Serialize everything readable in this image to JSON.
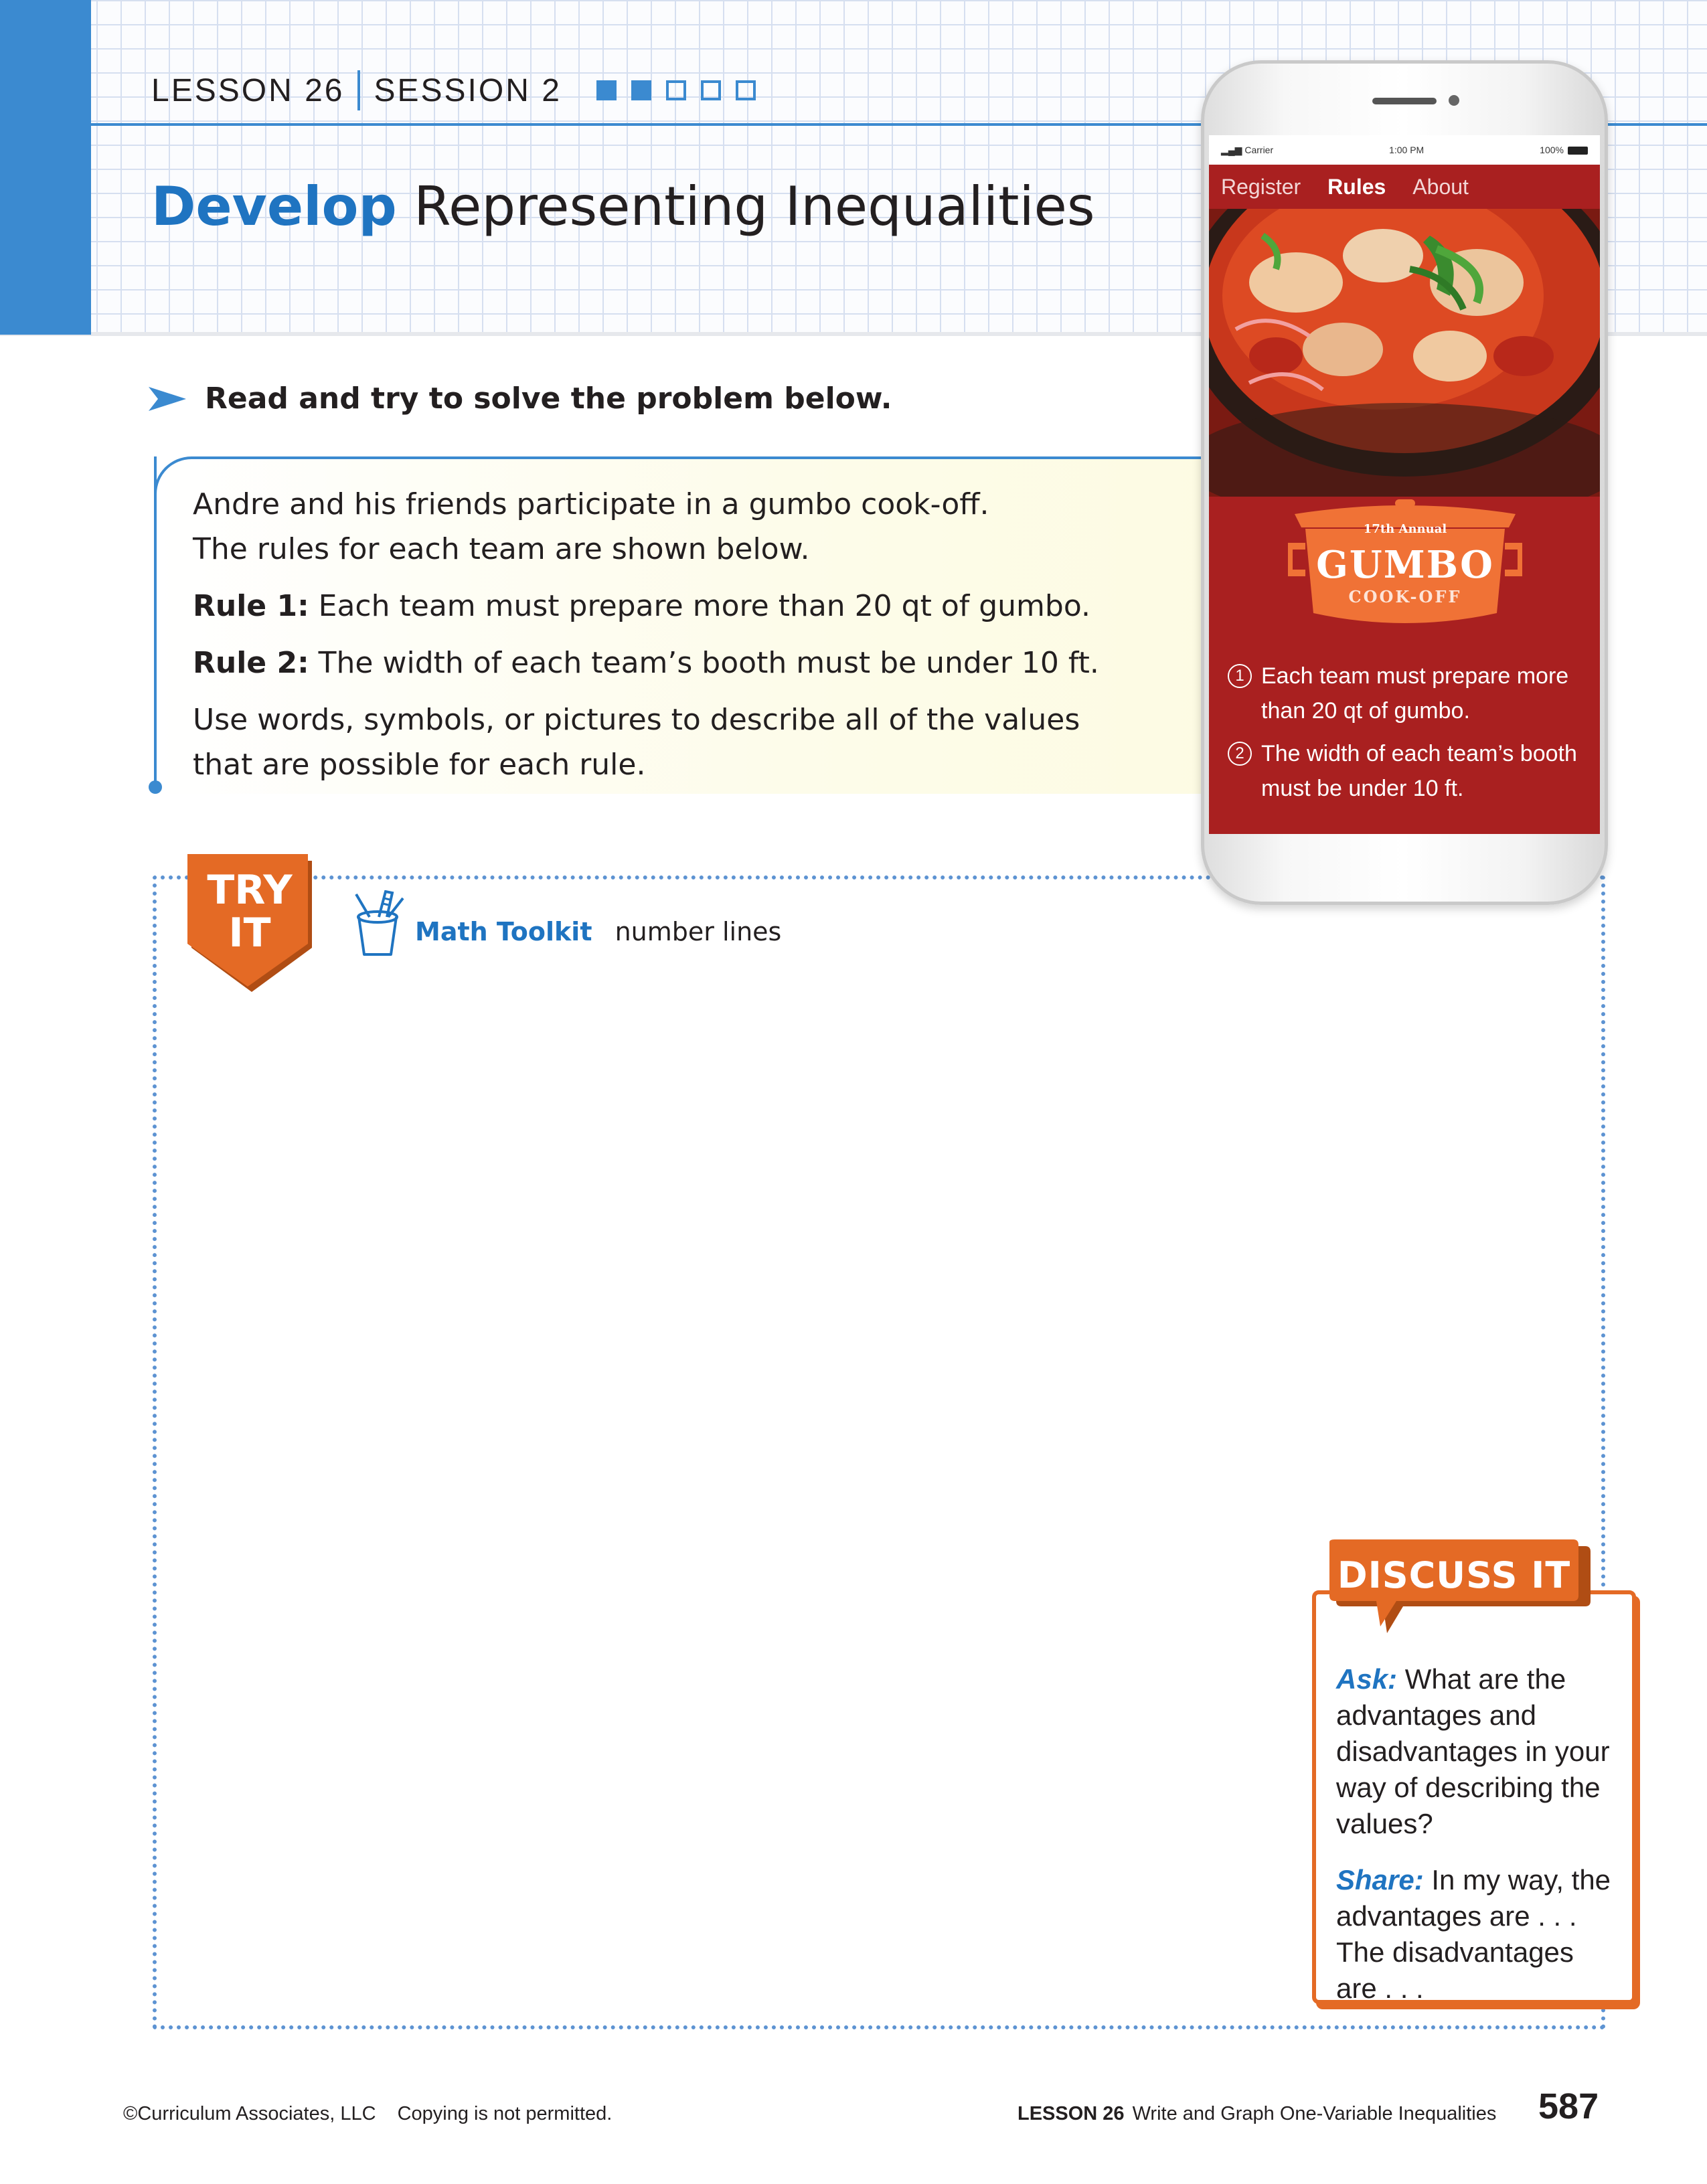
{
  "header": {
    "lesson": "LESSON 26",
    "session": "SESSION 2",
    "progress": {
      "filled": 2,
      "total": 5
    },
    "title_emphasis": "Develop",
    "title_rest": "Representing Inequalities"
  },
  "instruction": "Read and try to solve the problem below.",
  "problem": {
    "intro_line1": "Andre and his friends participate in a gumbo cook-off.",
    "intro_line2": "The rules for each team are shown below.",
    "rule1_label": "Rule 1:",
    "rule1_text": "Each team must prepare more than 20 qt of gumbo.",
    "rule2_label": "Rule 2:",
    "rule2_text": "The width of each team’s booth must be under 10 ft.",
    "prompt": "Use words, symbols, or pictures to describe all of the values that are possible for each rule."
  },
  "phone": {
    "status_left": "Carrier",
    "status_time": "1:00 PM",
    "status_battery": "100%",
    "nav": [
      "Register",
      "Rules",
      "About"
    ],
    "active_nav": "Rules",
    "logo_annual": "17th Annual",
    "logo_title": "GUMBO",
    "logo_subtitle": "COOK-OFF",
    "rules": [
      {
        "num": "1",
        "text": "Each team must prepare more than 20 qt of gumbo."
      },
      {
        "num": "2",
        "text": "The width of each team’s booth must be under 10 ft."
      }
    ]
  },
  "try_it": {
    "badge_line1": "TRY",
    "badge_line2": "IT",
    "toolkit_label": "Math Toolkit",
    "toolkit_items": "number lines"
  },
  "discuss": {
    "title": "DISCUSS IT",
    "ask_label": "Ask:",
    "ask_text": "What are the advantages and disadvantages in your way of describing the values?",
    "share_label": "Share:",
    "share_text": "In my way, the advantages are . . . The disadvantages are . . ."
  },
  "footer": {
    "copyright": "©Curriculum Associates, LLC",
    "notice": "Copying is not permitted.",
    "lesson_label": "LESSON 26",
    "lesson_title": "Write and Graph One-Variable Inequalities",
    "page_number": "587"
  },
  "colors": {
    "accent_blue": "#3b8ad0",
    "title_blue": "#1f74c1",
    "orange": "#e46a25",
    "phone_red": "#a92020"
  }
}
